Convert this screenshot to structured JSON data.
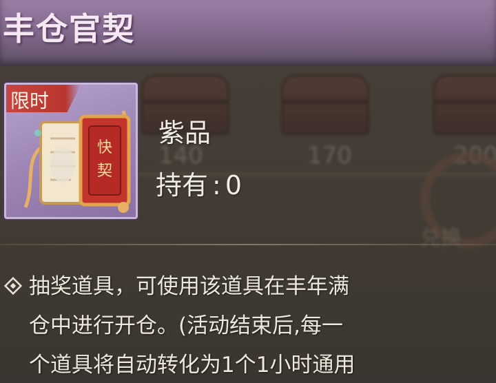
{
  "header": {
    "title": "丰仓官契"
  },
  "background": {
    "chest_values": [
      "140",
      "170",
      "200"
    ],
    "deco_text": "兑换"
  },
  "item": {
    "tag": "限时",
    "icon": "red-contract-book-icon",
    "rarity": "紫品",
    "owned_label": "持有",
    "owned_separator": ":",
    "owned_count": "0"
  },
  "description": {
    "icon": "diamond-bullet-icon",
    "lines": [
      "抽奖道具，可使用该道具在丰年满",
      "仓中进行开仓。(活动结束后,每一",
      "个道具将自动转化为1个1小时通用"
    ]
  },
  "colors": {
    "header_purple": "#7e6689",
    "panel_brown": "#403a33",
    "card_purple": "#9d86b6",
    "tag_red": "#c8453f",
    "text_light": "#f1ece4"
  }
}
